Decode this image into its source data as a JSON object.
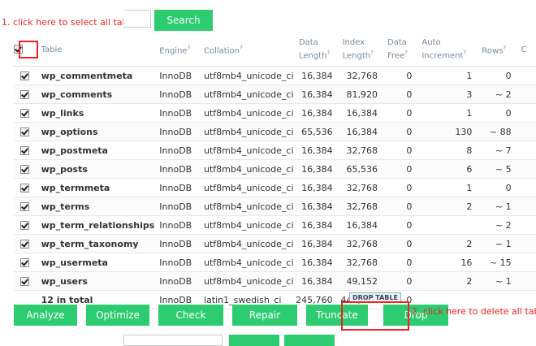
{
  "annotations": {
    "select_all_note": "1. click here to select all tables",
    "drop_note": "2. click here to delete all tables",
    "drop_tooltip": "DROP TABLE"
  },
  "search": {
    "button_label": "Search",
    "value": ""
  },
  "table": {
    "headers": {
      "table": "Table",
      "engine": "Engine",
      "collation": "Collation",
      "data_length_1": "Data",
      "data_length_2": "Length",
      "index_length_1": "Index",
      "index_length_2": "Length",
      "data_free_1": "Data",
      "data_free_2": "Free",
      "auto_increment_1": "Auto",
      "auto_increment_2": "Increment",
      "rows": "Rows",
      "more": "C",
      "help_mark": "?"
    },
    "rows": [
      {
        "name": "wp_commentmeta",
        "engine": "InnoDB",
        "collation": "utf8mb4_unicode_ci",
        "data_length": "16,384",
        "index_length": "32,768",
        "data_free": "0",
        "auto_increment": "1",
        "rows": "0"
      },
      {
        "name": "wp_comments",
        "engine": "InnoDB",
        "collation": "utf8mb4_unicode_ci",
        "data_length": "16,384",
        "index_length": "81,920",
        "data_free": "0",
        "auto_increment": "3",
        "rows": "~ 2"
      },
      {
        "name": "wp_links",
        "engine": "InnoDB",
        "collation": "utf8mb4_unicode_ci",
        "data_length": "16,384",
        "index_length": "16,384",
        "data_free": "0",
        "auto_increment": "1",
        "rows": "0"
      },
      {
        "name": "wp_options",
        "engine": "InnoDB",
        "collation": "utf8mb4_unicode_ci",
        "data_length": "65,536",
        "index_length": "16,384",
        "data_free": "0",
        "auto_increment": "130",
        "rows": "~ 88"
      },
      {
        "name": "wp_postmeta",
        "engine": "InnoDB",
        "collation": "utf8mb4_unicode_ci",
        "data_length": "16,384",
        "index_length": "32,768",
        "data_free": "0",
        "auto_increment": "8",
        "rows": "~ 7"
      },
      {
        "name": "wp_posts",
        "engine": "InnoDB",
        "collation": "utf8mb4_unicode_ci",
        "data_length": "16,384",
        "index_length": "65,536",
        "data_free": "0",
        "auto_increment": "6",
        "rows": "~ 5"
      },
      {
        "name": "wp_termmeta",
        "engine": "InnoDB",
        "collation": "utf8mb4_unicode_ci",
        "data_length": "16,384",
        "index_length": "32,768",
        "data_free": "0",
        "auto_increment": "1",
        "rows": "0"
      },
      {
        "name": "wp_terms",
        "engine": "InnoDB",
        "collation": "utf8mb4_unicode_ci",
        "data_length": "16,384",
        "index_length": "32,768",
        "data_free": "0",
        "auto_increment": "2",
        "rows": "~ 1"
      },
      {
        "name": "wp_term_relationships",
        "engine": "InnoDB",
        "collation": "utf8mb4_unicode_ci",
        "data_length": "16,384",
        "index_length": "16,384",
        "data_free": "0",
        "auto_increment": "",
        "rows": "~ 2"
      },
      {
        "name": "wp_term_taxonomy",
        "engine": "InnoDB",
        "collation": "utf8mb4_unicode_ci",
        "data_length": "16,384",
        "index_length": "32,768",
        "data_free": "0",
        "auto_increment": "2",
        "rows": "~ 1"
      },
      {
        "name": "wp_usermeta",
        "engine": "InnoDB",
        "collation": "utf8mb4_unicode_ci",
        "data_length": "16,384",
        "index_length": "32,768",
        "data_free": "0",
        "auto_increment": "16",
        "rows": "~ 15"
      },
      {
        "name": "wp_users",
        "engine": "InnoDB",
        "collation": "utf8mb4_unicode_ci",
        "data_length": "16,384",
        "index_length": "49,152",
        "data_free": "0",
        "auto_increment": "2",
        "rows": "~ 1"
      }
    ],
    "total": {
      "label": "12 in total",
      "engine": "InnoDB",
      "collation": "latin1_swedish_ci",
      "data_length": "245,760",
      "index_length": "442,368",
      "data_free": "0"
    }
  },
  "actions": {
    "analyze": "Analyze",
    "optimize": "Optimize",
    "check": "Check",
    "repair": "Repair",
    "truncate": "Truncate",
    "drop": "Drop"
  },
  "colors": {
    "accent": "#2ecc71",
    "annotation": "#ee2222"
  }
}
